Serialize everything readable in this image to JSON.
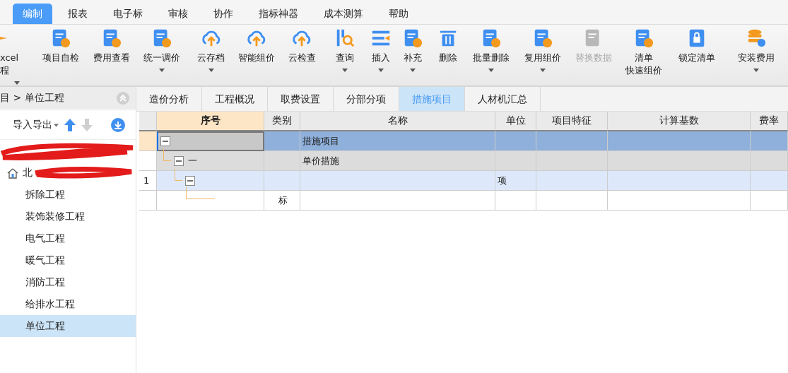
{
  "menu": [
    {
      "label": "编制",
      "selected": true
    },
    {
      "label": "报表",
      "selected": false
    },
    {
      "label": "电子标",
      "selected": false
    },
    {
      "label": "审核",
      "selected": false
    },
    {
      "label": "协作",
      "selected": false
    },
    {
      "label": "指标神器",
      "selected": false
    },
    {
      "label": "成本测算",
      "selected": false
    },
    {
      "label": "帮助",
      "selected": false
    }
  ],
  "toolbar": [
    {
      "label": "xcel",
      "label2": "程",
      "dropdown": true,
      "disabled": false
    },
    {
      "label": "项目自检",
      "dropdown": false,
      "disabled": false
    },
    {
      "label": "费用查看",
      "dropdown": false,
      "disabled": false
    },
    {
      "label": "统一调价",
      "dropdown": true,
      "disabled": false
    },
    {
      "label": "云存档",
      "dropdown": true,
      "disabled": false
    },
    {
      "label": "智能组价",
      "dropdown": false,
      "disabled": false
    },
    {
      "label": "云检查",
      "dropdown": false,
      "disabled": false
    },
    {
      "label": "查询",
      "dropdown": true,
      "disabled": false
    },
    {
      "label": "插入",
      "dropdown": true,
      "disabled": false
    },
    {
      "label": "补充",
      "dropdown": true,
      "disabled": false
    },
    {
      "label": "删除",
      "dropdown": false,
      "disabled": false
    },
    {
      "label": "批量删除",
      "dropdown": true,
      "disabled": false
    },
    {
      "label": "复用组价",
      "dropdown": true,
      "disabled": false
    },
    {
      "label": "替换数据",
      "dropdown": false,
      "disabled": true
    },
    {
      "label": "清单",
      "label2": "快速组价",
      "dropdown": false,
      "disabled": false
    },
    {
      "label": "锁定清单",
      "dropdown": false,
      "disabled": false
    },
    {
      "label": "安装费用",
      "dropdown": true,
      "disabled": false
    }
  ],
  "sidebar": {
    "breadcrumb": "目 > 单位工程",
    "import_export": "导入导出",
    "items": [
      {
        "kind": "redacted"
      },
      {
        "kind": "project",
        "label": "北",
        "children": [
          {
            "label": "拆除工程",
            "selected": false
          },
          {
            "label": "装饰装修工程",
            "selected": false
          },
          {
            "label": "电气工程",
            "selected": false
          },
          {
            "label": "暖气工程",
            "selected": false
          },
          {
            "label": "消防工程",
            "selected": false
          },
          {
            "label": "给排水工程",
            "selected": false
          },
          {
            "label": "单位工程",
            "selected": true
          }
        ]
      }
    ]
  },
  "tabs": [
    {
      "label": "造价分析",
      "selected": false
    },
    {
      "label": "工程概况",
      "selected": false
    },
    {
      "label": "取费设置",
      "selected": false
    },
    {
      "label": "分部分项",
      "selected": false
    },
    {
      "label": "措施项目",
      "selected": true
    },
    {
      "label": "人材机汇总",
      "selected": false
    }
  ],
  "table": {
    "columns": [
      "序号",
      "类别",
      "名称",
      "单位",
      "项目特征",
      "计算基数",
      "费率"
    ],
    "rows": [
      {
        "kind": "section",
        "selected": true,
        "expanded": true,
        "name": "措施项目",
        "children": [
          {
            "kind": "group",
            "selected": false,
            "expanded": true,
            "code": "一",
            "name": "单价措施",
            "children": [
              {
                "kind": "item",
                "selected": false,
                "expanded": true,
                "number": "1",
                "unit": "项",
                "children": [
                  {
                    "kind": "sub",
                    "selected": false,
                    "type": "标"
                  }
                ]
              }
            ]
          }
        ]
      }
    ]
  }
}
